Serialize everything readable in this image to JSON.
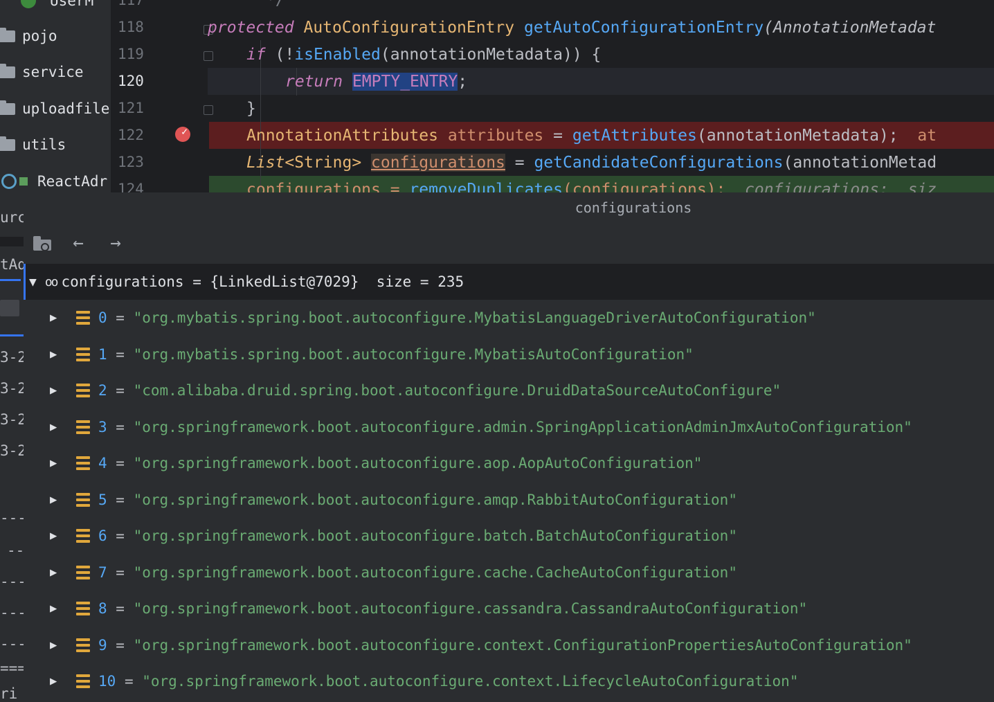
{
  "sidebar": {
    "items": [
      {
        "label": "UserMapper",
        "partial": "UserM"
      },
      {
        "label": "pojo"
      },
      {
        "label": "service"
      },
      {
        "label": "uploadfile"
      },
      {
        "label": "utils"
      },
      {
        "label": "ReactAdr"
      }
    ],
    "cut_texts": [
      "urc",
      "tAd",
      "3-2",
      "3-2",
      "3-2",
      "3-2",
      "---",
      "--",
      "---",
      "---",
      "---",
      "===",
      "ri"
    ]
  },
  "editor": {
    "line_numbers": [
      "117",
      "118",
      "119",
      "120",
      "121",
      "122",
      "123",
      "124"
    ],
    "current_line": "120",
    "breakpoint_line": "122",
    "lines": {
      "l117": "*/",
      "l118_kw": "protected",
      "l118_type": "AutoConfigurationEntry",
      "l118_fn": "getAutoConfigurationEntry",
      "l118_param": "(AnnotationMetadat",
      "l119_kw": "if",
      "l119_a": " (!",
      "l119_fn": "isEnabled",
      "l119_b": "(annotationMetadata)) {",
      "l120_kw": "return",
      "l120_const": "EMPTY_ENTRY",
      "l120_end": ";",
      "l121": "}",
      "l122_type": "AnnotationAttributes",
      "l122_var": "attributes",
      "l122_eq": " = ",
      "l122_fn": "getAttributes",
      "l122_b": "(annotationMetadata);",
      "l122_hint": "at",
      "l123_type": "List",
      "l123_gen": "<String>",
      "l123_var": "configurations",
      "l123_eq": " = ",
      "l123_fn": "getCandidateConfigurations",
      "l123_b": "(annotationMetad",
      "l124_a": "configurations = ",
      "l124_fn": "removeDuplicates",
      "l124_b": "(configurations);",
      "l124_hint": "configurations:  siz"
    }
  },
  "popup": {
    "title": "configurations",
    "toolbar": {
      "folder_icon": "folder-settings-icon",
      "back": "←",
      "forward": "→"
    },
    "root": {
      "name": "configurations",
      "value": "{LinkedList@7029}",
      "size_label": "size = 235"
    },
    "items": [
      {
        "index": "0",
        "value": "\"org.mybatis.spring.boot.autoconfigure.MybatisLanguageDriverAutoConfiguration\""
      },
      {
        "index": "1",
        "value": "\"org.mybatis.spring.boot.autoconfigure.MybatisAutoConfiguration\""
      },
      {
        "index": "2",
        "value": "\"com.alibaba.druid.spring.boot.autoconfigure.DruidDataSourceAutoConfigure\""
      },
      {
        "index": "3",
        "value": "\"org.springframework.boot.autoconfigure.admin.SpringApplicationAdminJmxAutoConfiguration\""
      },
      {
        "index": "4",
        "value": "\"org.springframework.boot.autoconfigure.aop.AopAutoConfiguration\""
      },
      {
        "index": "5",
        "value": "\"org.springframework.boot.autoconfigure.amqp.RabbitAutoConfiguration\""
      },
      {
        "index": "6",
        "value": "\"org.springframework.boot.autoconfigure.batch.BatchAutoConfiguration\""
      },
      {
        "index": "7",
        "value": "\"org.springframework.boot.autoconfigure.cache.CacheAutoConfiguration\""
      },
      {
        "index": "8",
        "value": "\"org.springframework.boot.autoconfigure.cassandra.CassandraAutoConfiguration\""
      },
      {
        "index": "9",
        "value": "\"org.springframework.boot.autoconfigure.context.ConfigurationPropertiesAutoConfiguration\""
      },
      {
        "index": "10",
        "value": "\"org.springframework.boot.autoconfigure.context.LifecycleAutoConfiguration\""
      }
    ]
  },
  "colors": {
    "background": "#2b2d30",
    "editor_bg": "#1e1f22",
    "breakpoint_line": "#5c1e1f",
    "exec_line": "#2c4a2e",
    "string": "#6aab73",
    "index": "#56a8f5",
    "keyword": "#cf8e6d"
  }
}
